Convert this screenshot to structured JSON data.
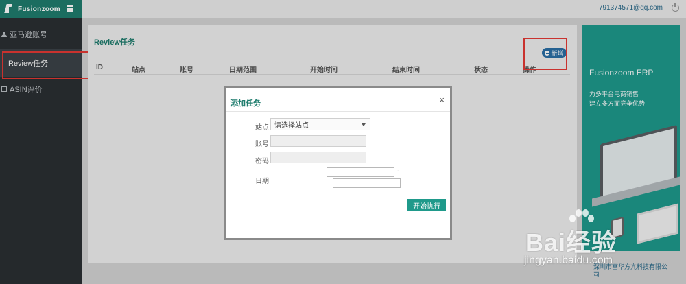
{
  "app": {
    "brand": "Fusionzoom",
    "user_email": "791374571@qq.com"
  },
  "sidebar": {
    "items": [
      {
        "label": "亚马逊账号",
        "icon": "user-icon"
      },
      {
        "label": "Review任务",
        "icon": "none",
        "active": true
      },
      {
        "label": "ASIN评价",
        "icon": "list-icon"
      }
    ]
  },
  "main": {
    "title": "Review任务",
    "new_button": "新增",
    "table_headers": [
      "ID",
      "站点",
      "账号",
      "日期范围",
      "开始时间",
      "结束时间",
      "状态",
      "操作"
    ]
  },
  "modal": {
    "title": "添加任务",
    "close": "×",
    "site_label": "站点",
    "site_placeholder": "请选择站点",
    "account_label": "账号",
    "account_value": "",
    "password_label": "密码",
    "password_value": "",
    "date_label": "日期",
    "date_start": "",
    "date_end": "",
    "date_separator": "-",
    "run_button": "开始执行"
  },
  "ad": {
    "title": "Fusionzoom ERP",
    "subtitle_line1": "为多平台电商销售",
    "subtitle_line2": "建立多方面竞争优势"
  },
  "footer": {
    "line1": "深圳市富华方亢科技有限公",
    "line2": "司"
  },
  "watermark": {
    "brand": "Bai经验",
    "url": "jingyan.baidu.com"
  },
  "colors": {
    "brand_teal": "#1f7d6e",
    "sidebar_bg": "#2b2f33",
    "new_button_blue": "#2b6fa6",
    "highlight_red": "#e53935"
  }
}
